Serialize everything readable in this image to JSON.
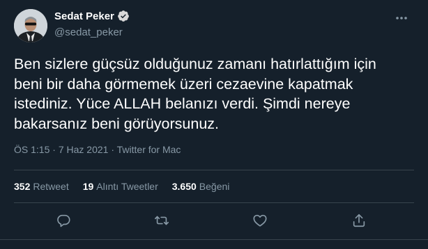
{
  "author": {
    "name": "Sedat Peker",
    "handle": "@sedat_peker",
    "verified": true
  },
  "tweet": {
    "text": "Ben sizlere güçsüz olduğunuz zamanı hatırlattığım için\nbeni bir daha görmemek üzeri cezaevine kapatmak\nistediniz. Yüce ALLAH belanızı verdi. Şimdi nereye\nbakarsanız beni görüyorsunuz.",
    "time": "ÖS 1:15",
    "separator": "·",
    "date": "7 Haz 2021",
    "source": "Twitter for Mac"
  },
  "stats": {
    "retweets": {
      "count": "352",
      "label": "Retweet"
    },
    "quotes": {
      "count": "19",
      "label": "Alıntı Tweetler"
    },
    "likes": {
      "count": "3.650",
      "label": "Beğeni"
    }
  },
  "icons": {
    "more": "more-icon",
    "reply": "reply-icon",
    "retweet": "retweet-icon",
    "like": "heart-icon",
    "share": "share-icon",
    "verified": "verified-badge-icon"
  },
  "colors": {
    "background": "#15202b",
    "primary_text": "#ffffff",
    "secondary_text": "#8899a6",
    "divider": "#38444d",
    "verified": "#d9d9d9"
  }
}
